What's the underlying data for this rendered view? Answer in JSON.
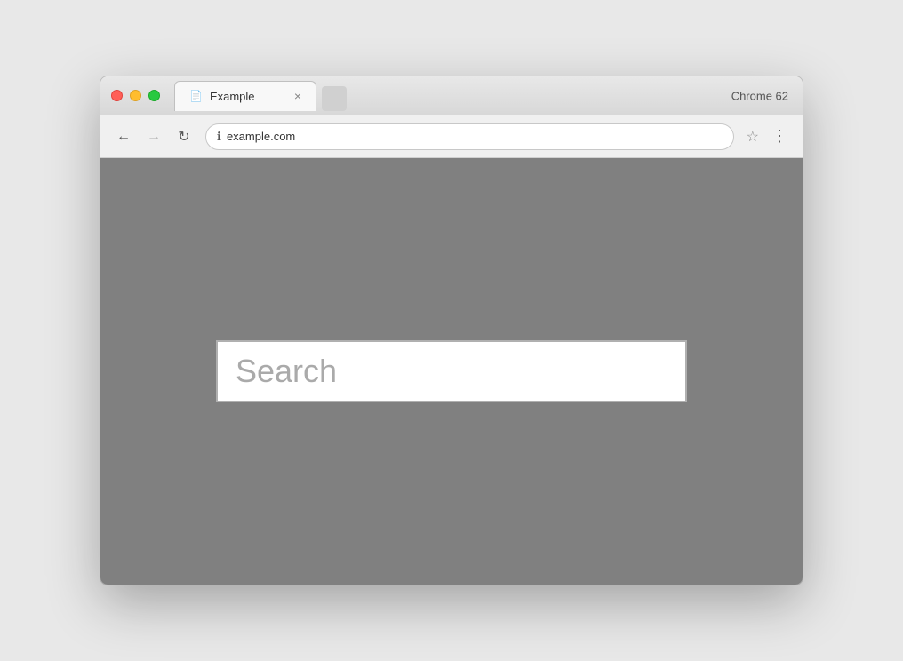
{
  "browser": {
    "chrome_version": "Chrome 62",
    "window_controls": {
      "close_label": "",
      "minimize_label": "",
      "maximize_label": ""
    },
    "tab": {
      "title": "Example",
      "icon": "📄",
      "close_symbol": "×"
    },
    "nav": {
      "back_symbol": "←",
      "forward_symbol": "→",
      "reload_symbol": "↻",
      "url": "example.com",
      "security_symbol": "ℹ",
      "star_symbol": "☆",
      "menu_symbol": "⋮"
    }
  },
  "page": {
    "search_placeholder": "Search",
    "background_color": "#808080"
  }
}
